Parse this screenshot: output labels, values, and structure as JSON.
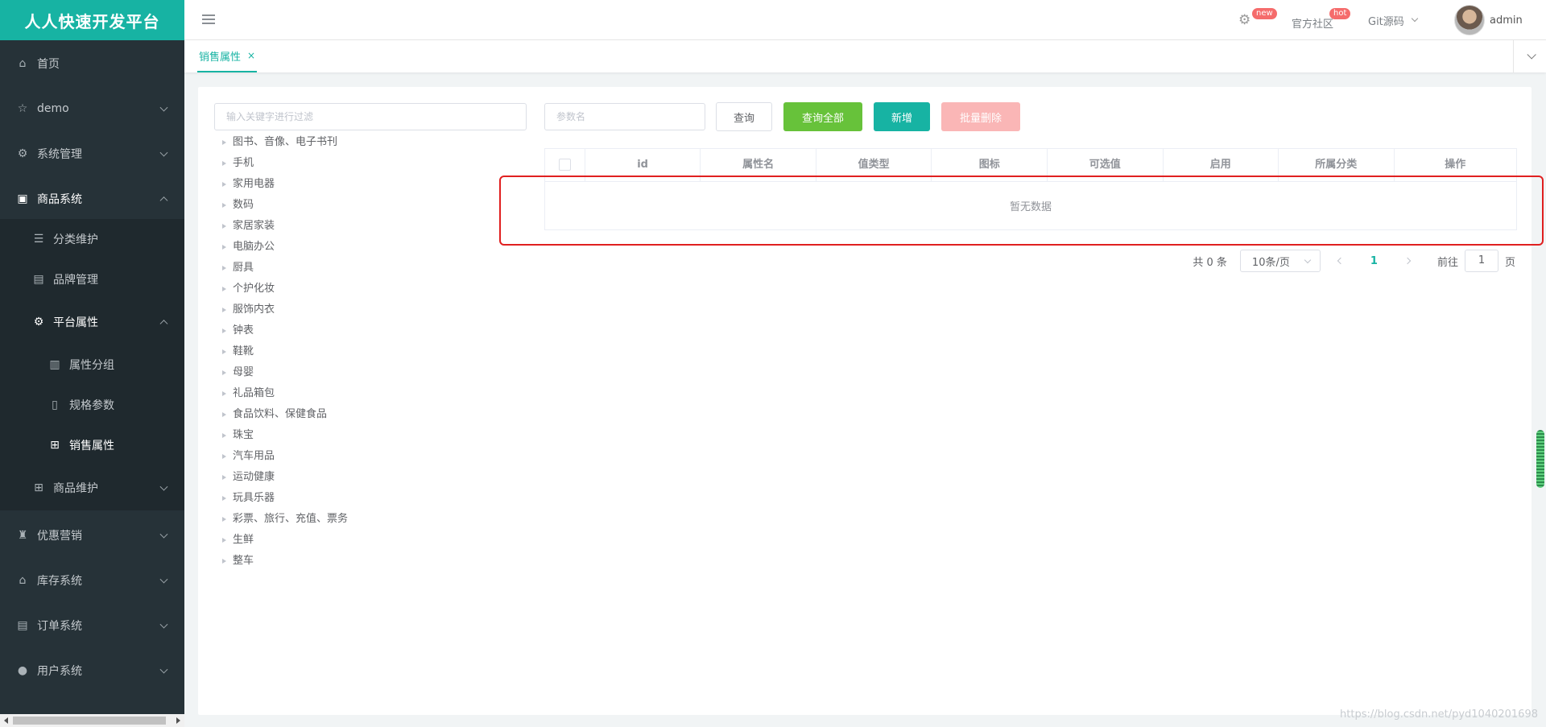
{
  "brand": "人人快速开发平台",
  "sidebar": {
    "items": [
      {
        "label": "首页",
        "icon": "home-icon"
      },
      {
        "label": "demo",
        "icon": "star-icon"
      },
      {
        "label": "系统管理",
        "icon": "gear-icon"
      },
      {
        "label": "商品系统",
        "icon": "product-icon"
      },
      {
        "label": "分类维护",
        "icon": "list-icon"
      },
      {
        "label": "品牌管理",
        "icon": "brand-icon"
      },
      {
        "label": "平台属性",
        "icon": "gear-icon"
      },
      {
        "label": "属性分组",
        "icon": "bar-chart-icon"
      },
      {
        "label": "规格参数",
        "icon": "document-icon"
      },
      {
        "label": "销售属性",
        "icon": "grid-icon"
      },
      {
        "label": "商品维护",
        "icon": "grid-icon"
      },
      {
        "label": "优惠营销",
        "icon": "trophy-icon"
      },
      {
        "label": "库存系统",
        "icon": "warehouse-icon"
      },
      {
        "label": "订单系统",
        "icon": "order-icon"
      },
      {
        "label": "用户系统",
        "icon": "user-icon"
      }
    ]
  },
  "topbar": {
    "badge_new": "new",
    "community": "官方社区",
    "badge_hot": "hot",
    "git": "Git源码",
    "user": "admin"
  },
  "tabs": [
    {
      "label": "销售属性",
      "close": "×"
    }
  ],
  "filter_placeholder": "输入关键字进行过滤",
  "tree": [
    "图书、音像、电子书刊",
    "手机",
    "家用电器",
    "数码",
    "家居家装",
    "电脑办公",
    "厨具",
    "个护化妆",
    "服饰内衣",
    "钟表",
    "鞋靴",
    "母婴",
    "礼品箱包",
    "食品饮料、保健食品",
    "珠宝",
    "汽车用品",
    "运动健康",
    "玩具乐器",
    "彩票、旅行、充值、票务",
    "生鲜",
    "整车"
  ],
  "search": {
    "placeholder": "参数名",
    "query": "查询",
    "query_all": "查询全部",
    "add": "新增",
    "batch_delete": "批量删除"
  },
  "table": {
    "columns": [
      "id",
      "属性名",
      "值类型",
      "图标",
      "可选值",
      "启用",
      "所属分类",
      "操作"
    ],
    "empty": "暂无数据"
  },
  "pagination": {
    "total": "共 0 条",
    "page_size": "10条/页",
    "current": "1",
    "goto_label": "前往",
    "goto_value": "1",
    "page_suffix": "页"
  },
  "watermark": "https://blog.csdn.net/pyd1040201698",
  "colors": {
    "accent": "#17b3a3",
    "sidebar": "#263238",
    "success": "#67c23a",
    "danger_light": "#fab6b6",
    "highlight": "#e02020"
  }
}
